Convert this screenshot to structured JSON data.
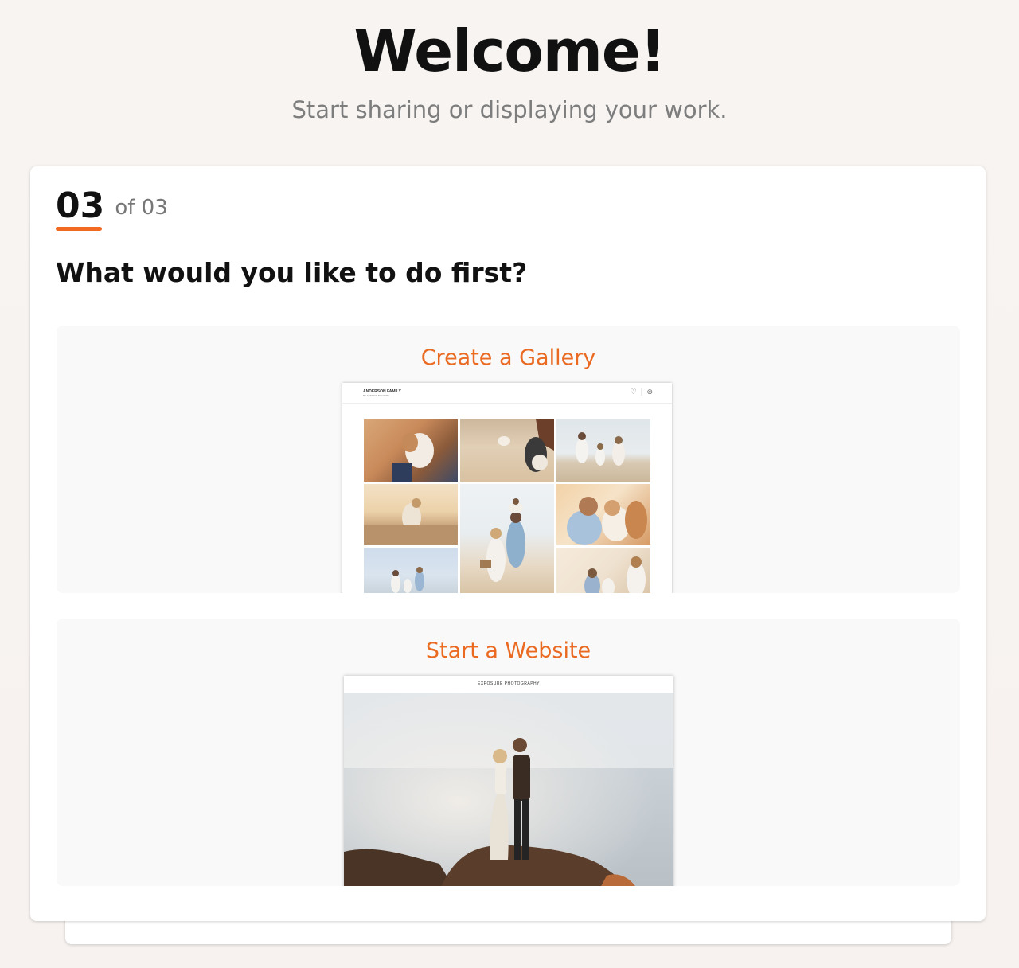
{
  "header": {
    "title": "Welcome!",
    "subtitle": "Start sharing or displaying your work."
  },
  "step": {
    "current": "03",
    "total": "of 03"
  },
  "question": "What would you like to do first?",
  "options": [
    {
      "label": "Create a Gallery",
      "preview": {
        "title": "ANDERSON FAMILY",
        "subtitle": "BY ANDREW BALDWIN"
      }
    },
    {
      "label": "Start a Website",
      "preview": {
        "title": "EXPOSURE PHOTOGRAPHY"
      }
    }
  ],
  "colors": {
    "accent": "#ea6a22",
    "underline": "#f06a22",
    "background": "#f7f4f2",
    "option_bg": "#f9f9f9"
  },
  "icons": [
    "heart-icon",
    "account-icon"
  ]
}
